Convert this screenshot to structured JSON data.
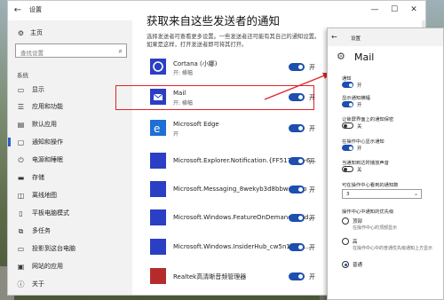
{
  "window": {
    "title": "设置",
    "controls": [
      "—",
      "☐",
      "✕"
    ]
  },
  "nav": {
    "home": "主页",
    "search_placeholder": "查找设置",
    "section": "系统",
    "items": [
      {
        "label": "显示",
        "icon": "monitor-icon"
      },
      {
        "label": "应用和功能",
        "icon": "apps-icon"
      },
      {
        "label": "默认应用",
        "icon": "default-apps-icon"
      },
      {
        "label": "通知和操作",
        "icon": "notification-icon",
        "active": true
      },
      {
        "label": "电源和睡眠",
        "icon": "power-icon"
      },
      {
        "label": "存储",
        "icon": "storage-icon"
      },
      {
        "label": "离线地图",
        "icon": "map-icon"
      },
      {
        "label": "平板电脑模式",
        "icon": "tablet-icon"
      },
      {
        "label": "多任务",
        "icon": "multitask-icon"
      },
      {
        "label": "投影到这台电脑",
        "icon": "project-icon"
      },
      {
        "label": "网站的应用",
        "icon": "web-apps-icon"
      },
      {
        "label": "关于",
        "icon": "info-icon"
      }
    ]
  },
  "content": {
    "title": "获取来自这些发送者的通知",
    "description": "选择发送者可查看更多设置。一些发送者还可能有其自己的通知设置。如果是这样，打开发送者即可将其打开。",
    "apps": [
      {
        "name": "Cortana (小娜)",
        "sub": "开: 横幅",
        "toggle": "开",
        "icon_color": "#2b3fc4",
        "icon": "cortana-icon"
      },
      {
        "name": "Mail",
        "sub": "开: 横幅",
        "toggle": "开",
        "icon_color": "#2b3fc4",
        "icon": "mail-icon"
      },
      {
        "name": "Microsoft Edge",
        "sub": "开",
        "toggle": "开",
        "icon_color": "#1e6fd6",
        "icon": "edge-icon"
      },
      {
        "name": "Microsoft.Explorer.Notification.{FF517D26-6...",
        "sub": "",
        "toggle": "开",
        "icon_color": "#2b3fc4",
        "icon": "app-icon"
      },
      {
        "name": "Microsoft.Messaging_8wekyb3d8bbwe!App",
        "sub": "",
        "toggle": "开",
        "icon_color": "#2b3fc4",
        "icon": "app-icon"
      },
      {
        "name": "Microsoft.Windows.FeatureOnDemand.Insid...",
        "sub": "",
        "toggle": "开",
        "icon_color": "#2b3fc4",
        "icon": "app-icon"
      },
      {
        "name": "Microsoft.Windows.InsiderHub_cw5n1h2tx...",
        "sub": "",
        "toggle": "开",
        "icon_color": "#2b3fc4",
        "icon": "app-icon"
      },
      {
        "name": "Realtek高清晰音频管理器",
        "sub": "",
        "toggle": "开",
        "icon_color": "#b52b2b",
        "icon": "realtek-icon"
      }
    ]
  },
  "popup": {
    "title": "设置",
    "heading": "Mail",
    "sections": [
      {
        "label": "通知",
        "toggle": "开",
        "on": true
      },
      {
        "label": "显示通知横幅",
        "toggle": "开",
        "on": true
      },
      {
        "label": "让锁屏界面上的通知保密",
        "toggle": "关",
        "on": false
      },
      {
        "label": "在操作中心显示通知",
        "toggle": "开",
        "on": true
      },
      {
        "label": "当通知到达时播放声音",
        "toggle": "关",
        "on": false
      }
    ],
    "count_label": "可在操作中心看到的通知数",
    "count_value": "3",
    "priority_label": "操作中心中通知的优先级",
    "priority_options": [
      {
        "label": "顶部",
        "sub": "在操作中心的顶部显示",
        "selected": false
      },
      {
        "label": "高",
        "sub": "在操作中心中的普通优先级通知上方显示",
        "selected": false
      },
      {
        "label": "普通",
        "sub": "",
        "selected": true
      }
    ]
  },
  "watermark": "www.PCHOME.NET",
  "colors": {
    "accent": "#1c4fae",
    "highlight": "#e0242b",
    "app_tile": "#2b3fc4"
  }
}
